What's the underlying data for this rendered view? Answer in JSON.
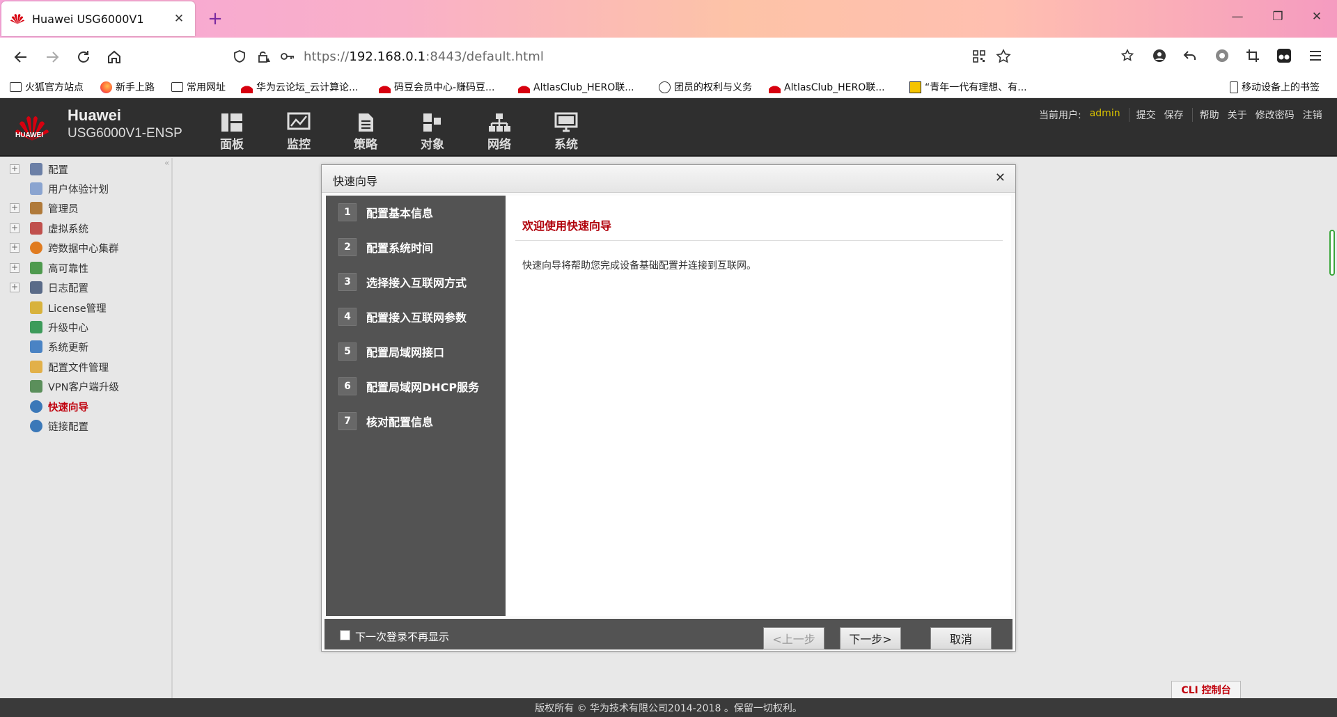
{
  "browser": {
    "tab_title": "Huawei USG6000V1",
    "url_protocol": "https://",
    "url_host": "192.168.0.1",
    "url_rest": ":8443/default.html",
    "bookmarks": [
      "火狐官方站点",
      "新手上路",
      "常用网址",
      "华为云论坛_云计算论...",
      "码豆会员中心-赚码豆...",
      "AltlasClub_HERO联...",
      "团员的权利与义务",
      "AltlasClub_HERO联...",
      "“青年一代有理想、有...",
      "移动设备上的书签"
    ]
  },
  "header": {
    "brand_line1": "Huawei",
    "brand_line2": "USG6000V1-ENSP",
    "logo_text": "HUAWEI",
    "nav": [
      "面板",
      "监控",
      "策略",
      "对象",
      "网络",
      "系统"
    ],
    "user_label": "当前用户:",
    "user_name": "admin",
    "actions": [
      "提交",
      "保存",
      "帮助",
      "关于",
      "修改密码",
      "注销"
    ]
  },
  "sidebar": {
    "items": [
      {
        "label": "配置",
        "expandable": true
      },
      {
        "label": "用户体验计划",
        "expandable": false
      },
      {
        "label": "管理员",
        "expandable": true
      },
      {
        "label": "虚拟系统",
        "expandable": true
      },
      {
        "label": "跨数据中心集群",
        "expandable": true
      },
      {
        "label": "高可靠性",
        "expandable": true
      },
      {
        "label": "日志配置",
        "expandable": true
      },
      {
        "label": "License管理",
        "expandable": false
      },
      {
        "label": "升级中心",
        "expandable": false
      },
      {
        "label": "系统更新",
        "expandable": false
      },
      {
        "label": "配置文件管理",
        "expandable": false
      },
      {
        "label": "VPN客户端升级",
        "expandable": false
      },
      {
        "label": "快速向导",
        "expandable": false,
        "active": true
      },
      {
        "label": "链接配置",
        "expandable": false
      }
    ]
  },
  "dialog": {
    "title": "快速向导",
    "steps": [
      {
        "num": "1",
        "label": "配置基本信息"
      },
      {
        "num": "2",
        "label": "配置系统时间"
      },
      {
        "num": "3",
        "label": "选择接入互联网方式"
      },
      {
        "num": "4",
        "label": "配置接入互联网参数"
      },
      {
        "num": "5",
        "label": "配置局域网接口"
      },
      {
        "num": "6",
        "label": "配置局域网DHCP服务"
      },
      {
        "num": "7",
        "label": "核对配置信息"
      }
    ],
    "welcome": "欢迎使用快速向导",
    "description": "快速向导将帮助您完成设备基础配置并连接到互联网。",
    "checkbox_label": "下一次登录不再显示",
    "prev_label": "<上一步",
    "next_label": "下一步>",
    "cancel_label": "取消"
  },
  "cli_label": "CLI 控制台",
  "footer_text": "版权所有 © 华为技术有限公司2014-2018 。保留一切权利。",
  "colors": {
    "accent_red": "#c0000c",
    "header_bg": "#2f2f2f",
    "step_panel": "#535353"
  }
}
